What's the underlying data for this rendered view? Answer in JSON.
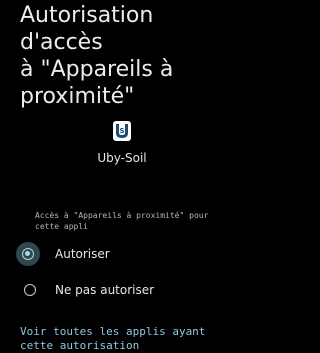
{
  "header": {
    "title": "Autorisation d'accès\nà \"Appareils à\nproximité\""
  },
  "app": {
    "name": "Uby-Soil",
    "icon": "uby-soil-app-icon"
  },
  "permission": {
    "access_label": "Accès à \"Appareils à proximité\" pour cette appli",
    "options": [
      {
        "label": "Autoriser",
        "selected": true
      },
      {
        "label": "Ne pas autoriser",
        "selected": false
      }
    ]
  },
  "footer": {
    "see_all_link": "Voir toutes les applis ayant cette autorisation"
  },
  "colors": {
    "background": "#000000",
    "accent": "#a9d8e6",
    "link": "#8fc7e0",
    "selection_halo": "#30474b"
  }
}
